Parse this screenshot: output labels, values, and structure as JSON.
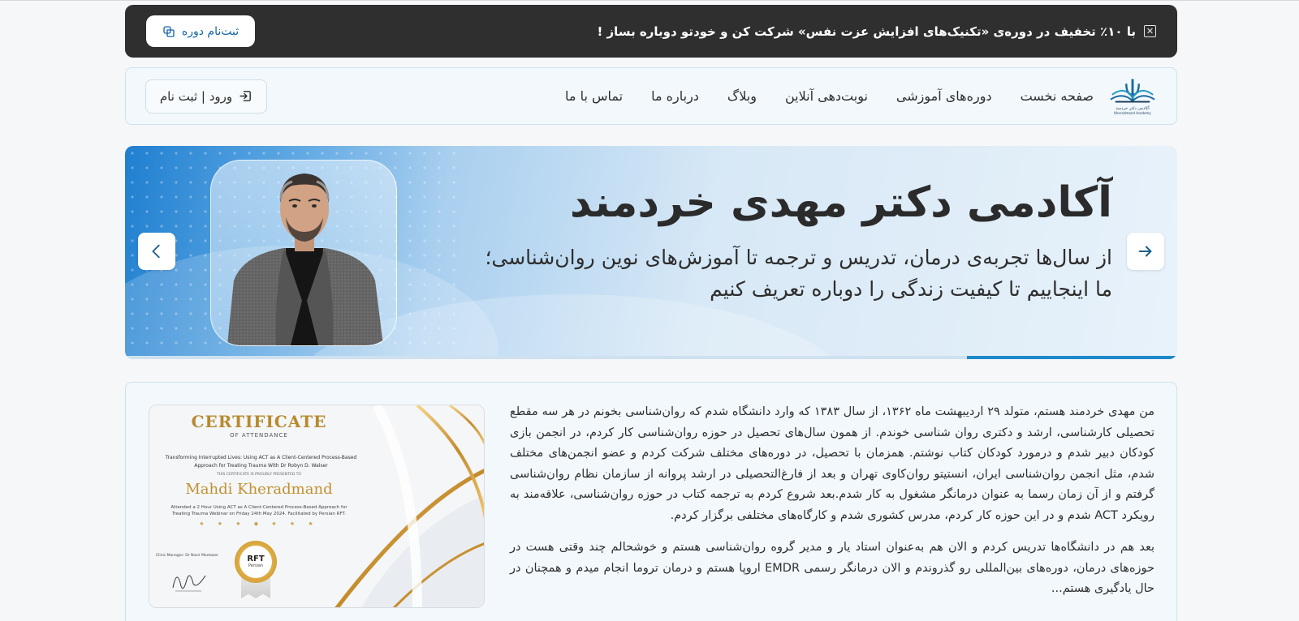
{
  "announcement": {
    "message": "با ۱۰٪ تخفیف در دوره‌ی «تکنیک‌های افزایش عزت نفس» شرکت کن و خودتو دوباره بساز !",
    "button_label": "ثبت‌نام دوره",
    "close_icon": "close-icon"
  },
  "nav": {
    "links": [
      "صفحه نخست",
      "دوره‌های آموزشی",
      "نوبت‌دهی آنلاین",
      "وبلاگ",
      "درباره ما",
      "تماس با ما"
    ],
    "login_label": "ورود | ثبت نام",
    "logo_text_fa": "آکادمی دکتر خردمند",
    "logo_text_en": "Kheradmand Academy"
  },
  "hero": {
    "title": "آکادمی دکتر مهدی خردمند",
    "line1": "از سال‌ها تجربه‌ی درمان، تدریس و ترجمه تا آموزش‌های نوین روان‌شناسی؛",
    "line2": "ما اینجاییم تا کیفیت زندگی را دوباره تعریف کنیم",
    "slider_progress": 0.2,
    "colors": {
      "accent": "#1e88c8",
      "bg_dark": "#1f7fd0",
      "bg_light": "#e8f2fa"
    }
  },
  "about": {
    "paragraph1": "من مهدی خردمند هستم، متولد ۲۹ اردیبهشت ماه ۱۳۶۲، از سال ۱۳۸۳ که وارد دانشگاه شدم که روان‌شناسی بخونم در هر سه مقطع تحصیلی کارشناسی، ارشد و دکتری روان شناسی خوندم. از همون سال‌های تحصیل در حوزه روان‌شناسی کار کردم، در انجمن بازی کودکان دبیر شدم و درمورد کودکان کتاب نوشتم. همزمان با تحصیل، در دوره‌های مختلف شرکت کردم و عضو انجمن‌های مختلف شدم، مثل انجمن روان‌شناسی ایران، انستیتو روان‌کاوی تهران و بعد از فارغ‌التحصیلی در ارشد پروانه از سازمان نظام روان‌شناسی گرفتم و از آن زمان رسما به عنوان درمانگر مشغول به کار شدم.بعد شروع کردم به ترجمه کتاب در حوزه روان‌شناسی، علاقه‌مند به رویکرد ACT شدم و در این حوزه کار کردم، مدرس کشوری شدم و کارگاه‌های مختلفی برگزار کردم.",
    "paragraph2": "بعد هم در دانشگاه‌ها تدریس کردم و الان هم به‌عنوان استاد یار و مدیر گروه روان‌شناسی هستم و خوشحالم چند وقتی هست در حوزه‌های درمان، دوره‌های بین‌المللی رو گذروندم و الان درمانگر رسمی EMDR اروپا هستم و درمان تروما انجام میدم و همچنان در حال یادگیری هستم..."
  },
  "certificate": {
    "title": "CERTIFICATE",
    "subtitle": "OF ATTENDANCE",
    "course": "Transforming Interrupted Lives: Using ACT as A Client-Centered Process-Based Approach for Treating Trauma With Dr Robyn D. Walser",
    "presented": "THIS CERTIFICATE IS PROUDLY PRESENTED TO",
    "name": "Mahdi Kheradmand",
    "attended": "Attended a 2 Hour Using ACT as A Client-Centered Process-Based Approach for Treating Trauma Webinar on Friday 24th May 2024. Facilitated by Persian RFT.",
    "stars": "★ ★ ★ ◆ ★ ★ ★",
    "manager": "Clinic Manager: Dr Nasir Montazer",
    "seal_main": "RFT",
    "seal_sub": "Persian"
  }
}
